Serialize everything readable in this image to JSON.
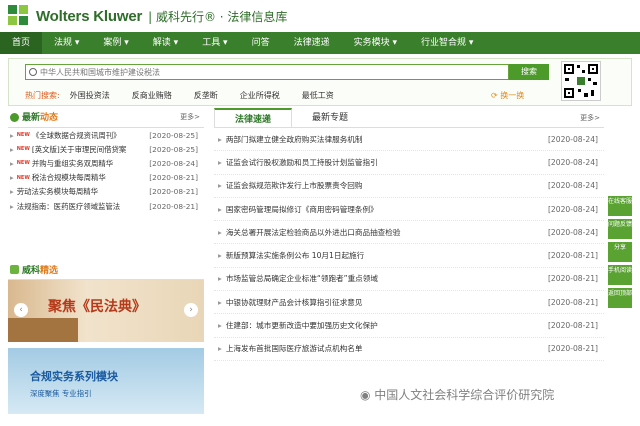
{
  "header": {
    "brand": "Wolters Kluwer",
    "brand_cn": "| 威科先行® · 法律信息库"
  },
  "nav": [
    {
      "label": "首页"
    },
    {
      "label": "法规 ▾"
    },
    {
      "label": "案例 ▾"
    },
    {
      "label": "解读 ▾"
    },
    {
      "label": "工具 ▾"
    },
    {
      "label": "问答"
    },
    {
      "label": "法律速递"
    },
    {
      "label": "实务模块 ▾"
    },
    {
      "label": "行业智合规 ▾"
    }
  ],
  "search": {
    "placeholder": "中华人民共和国城市维护建设税法",
    "button": "搜索",
    "hot_label": "热门搜索:",
    "hot_keywords": [
      "外国投资法",
      "反商业贿赂",
      "反垄断",
      "企业所得税",
      "最低工资"
    ],
    "refresh": "换一换"
  },
  "latest": {
    "title_a": "最新",
    "title_b": "动态",
    "more": "更多>",
    "items": [
      {
        "badge": "NEW",
        "text": "《全球数据合规资讯周刊》",
        "date": "[2020-08-25]"
      },
      {
        "badge": "NEW",
        "text": "[英文版]关于审理民间借贷案",
        "date": "[2020-08-25]"
      },
      {
        "badge": "NEW",
        "text": "并购与重组实务双周精华",
        "date": "[2020-08-24]"
      },
      {
        "badge": "NEW",
        "text": "税法合规模块每周精华",
        "date": "[2020-08-21]"
      },
      {
        "badge": "",
        "text": "劳动法实务模块每周精华",
        "date": "[2020-08-21]"
      },
      {
        "badge": "",
        "text": "法规指南：医药医疗领域监管法",
        "date": "[2020-08-21]"
      }
    ]
  },
  "featured": {
    "title_a": "威科",
    "title_b": "精选"
  },
  "banner_a": {
    "text": "聚焦《民法典》"
  },
  "banner_b": {
    "title": "合规实务系列模块",
    "subtitle": "深度聚焦 专业指引"
  },
  "tabs": [
    {
      "label": "法律速递"
    },
    {
      "label": "最新专题"
    }
  ],
  "mid": {
    "more": "更多>",
    "items": [
      {
        "text": "两部门拟建立健全政府购买法律服务机制",
        "date": "[2020-08-24]"
      },
      {
        "text": "证监会试行股权激励和员工持股计划监管指引",
        "date": "[2020-08-24]"
      },
      {
        "text": "证监会拟规范欺诈发行上市股票责令回购",
        "date": "[2020-08-24]"
      },
      {
        "text": "国家密码管理局拟修订《商用密码管理条例》",
        "date": "[2020-08-24]"
      },
      {
        "text": "海关总署开展法定检验商品以外进出口商品抽查检验",
        "date": "[2020-08-24]"
      },
      {
        "text": "新版预算法实施条例公布 10月1日起施行",
        "date": "[2020-08-21]"
      },
      {
        "text": "市场监管总局确定企业标准“领跑者”重点领域",
        "date": "[2020-08-21]"
      },
      {
        "text": "中银协就理财产品会计核算指引征求意见",
        "date": "[2020-08-21]"
      },
      {
        "text": "住建部：城市更新改造中要加强历史文化保护",
        "date": "[2020-08-21]"
      },
      {
        "text": "上海发布首批国际医疗旅游试点机构名单",
        "date": "[2020-08-21]"
      }
    ]
  },
  "tools": [
    {
      "label": "在线客服"
    },
    {
      "label": "问题反馈"
    },
    {
      "label": "分享"
    },
    {
      "label": "手机阅读"
    },
    {
      "label": "返回顶部"
    }
  ],
  "watermark": "中国人文社会科学综合评价研究院",
  "colors": {
    "brand_green": "#3a7f2b",
    "accent_orange": "#e07a1a"
  }
}
